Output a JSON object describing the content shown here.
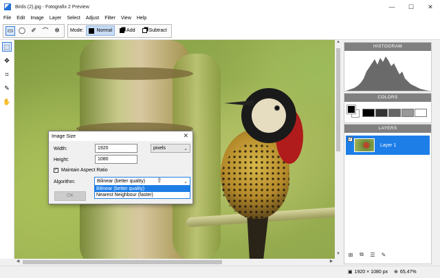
{
  "window": {
    "title": "Birds (2).jpg - Fotografix 2 Preview",
    "minimize_glyph": "—",
    "maximize_glyph": "☐",
    "close_glyph": "✕"
  },
  "menu": [
    "File",
    "Edit",
    "Image",
    "Layer",
    "Select",
    "Adjust",
    "Filter",
    "View",
    "Help"
  ],
  "toolbar": {
    "selection_tools": [
      {
        "name": "rectangle-select-icon",
        "glyph": "▭",
        "active": true
      },
      {
        "name": "ellipse-select-icon",
        "glyph": "◯",
        "active": false
      },
      {
        "name": "lasso-icon",
        "glyph": "✐",
        "active": false
      },
      {
        "name": "polygon-lasso-icon",
        "glyph": "⌒",
        "active": false
      },
      {
        "name": "magic-wand-icon",
        "glyph": "✲",
        "active": false
      }
    ],
    "mode_label": "Mode:",
    "modes": [
      {
        "name": "normal",
        "label": "Normal",
        "active": true
      },
      {
        "name": "add",
        "label": "Add",
        "active": false
      },
      {
        "name": "subtract",
        "label": "Subtract",
        "active": false
      }
    ]
  },
  "left_tools": [
    {
      "name": "marquee-tool-icon",
      "glyph": "⬚",
      "active": true
    },
    {
      "name": "move-tool-icon",
      "glyph": "✥",
      "active": false
    },
    {
      "name": "crop-tool-icon",
      "glyph": "⌗",
      "active": false
    },
    {
      "name": "brush-tool-icon",
      "glyph": "✎",
      "active": false
    },
    {
      "name": "hand-tool-icon",
      "glyph": "✋",
      "active": false
    }
  ],
  "scroll": {
    "up": "▲",
    "down": "▼",
    "left": "◀",
    "right": "▶"
  },
  "panels": {
    "histogram_title": "HISTOGRAM",
    "colors_title": "COLORS",
    "layers_title": "LAYERS"
  },
  "colors": {
    "foreground": "#000000",
    "background": "#ffffff",
    "palette": [
      "#000000",
      "#333333",
      "#666666",
      "#999999",
      "#ffffff"
    ]
  },
  "layers": [
    {
      "name": "Layer 1",
      "visible": true,
      "check": "✓"
    }
  ],
  "layer_tools": [
    {
      "name": "new-layer-icon",
      "glyph": "⊞"
    },
    {
      "name": "duplicate-layer-icon",
      "glyph": "⧉"
    },
    {
      "name": "layer-properties-icon",
      "glyph": "☰"
    },
    {
      "name": "adjust-layer-icon",
      "glyph": "✎"
    }
  ],
  "status": {
    "dimensions": "1920 × 1080 px",
    "zoom": "65,47%",
    "image_icon": "▣",
    "zoom_icon": "⊕"
  },
  "dialog": {
    "title": "Image Size",
    "close": "✕",
    "width_label": "Width:",
    "width_value": "1920",
    "height_label": "Height:",
    "height_value": "1080",
    "unit": "pixels",
    "maintain_label": "Maintain Aspect Ratio",
    "maintain_checked": "✓",
    "algorithm_label": "Algorithm:",
    "algorithm_value": "Bilinear (better quality)",
    "algorithm_options": [
      "Bilinear (better quality)",
      "Nearest Neighbour (faster)"
    ],
    "ok_label": "OK",
    "chevron": "⌄"
  }
}
